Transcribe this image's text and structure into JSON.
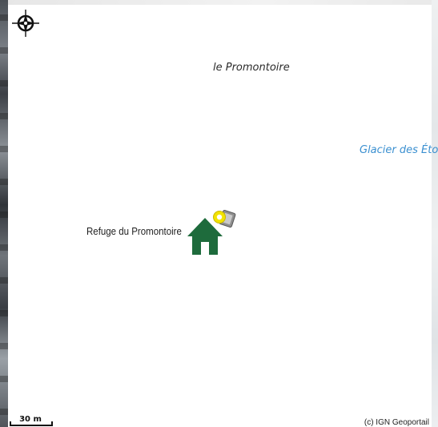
{
  "map": {
    "labels": {
      "promontoire": "le Promontoire",
      "glacier": "Glacier des Éto",
      "refuge": "Refuge du Promontoire"
    },
    "compass_icon": "compass-rose-icon",
    "marker_icon": "house-icon",
    "marker_color": "#1e6b3c",
    "pin_color": "#f2e200",
    "scale_bar": {
      "label": "30 m"
    },
    "attribution": "(c) IGN Geoportail"
  }
}
